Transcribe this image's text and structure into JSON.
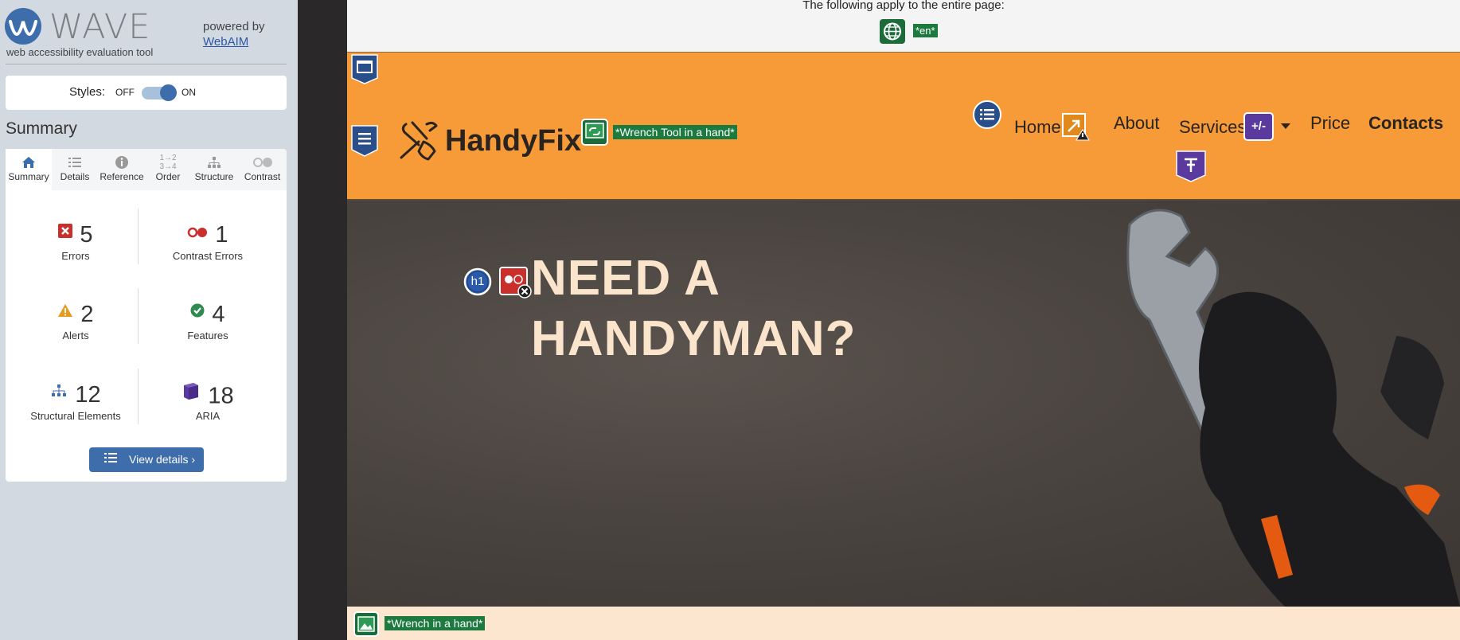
{
  "wave": {
    "title": "WAVE",
    "subtitle": "web accessibility evaluation tool",
    "powered_by": "powered by",
    "webaim_link": "WebAIM",
    "styles": {
      "label": "Styles:",
      "off": "OFF",
      "on": "ON",
      "state": "on"
    },
    "summary_heading": "Summary",
    "tabs": [
      {
        "label": "Summary",
        "icon": "home-icon"
      },
      {
        "label": "Details",
        "icon": "list-icon"
      },
      {
        "label": "Reference",
        "icon": "info-icon"
      },
      {
        "label": "Order",
        "icon": "order-icon"
      },
      {
        "label": "Structure",
        "icon": "structure-icon"
      },
      {
        "label": "Contrast",
        "icon": "contrast-icon"
      }
    ],
    "stats": {
      "errors": {
        "value": "5",
        "label": "Errors"
      },
      "contrast_errors": {
        "value": "1",
        "label": "Contrast Errors"
      },
      "alerts": {
        "value": "2",
        "label": "Alerts"
      },
      "features": {
        "value": "4",
        "label": "Features"
      },
      "structural": {
        "value": "12",
        "label": "Structural Elements"
      },
      "aria": {
        "value": "18",
        "label": "ARIA"
      }
    },
    "view_details": "View details ›"
  },
  "page": {
    "notice": "The following apply to the entire page:",
    "lang_label": "*en*",
    "brand": "HandyFix",
    "logo_alt": "*Wrench Tool in a hand*",
    "nav": [
      "Home",
      "About",
      "Services",
      "Price",
      "Contacts"
    ],
    "aria_plusminus": "+/-",
    "hero_heading": "NEED A HANDYMAN?",
    "h1_badge": "h1",
    "hero_image_alt": "*Wrench in a hand*"
  },
  "colors": {
    "wave_blue": "#3d6dab",
    "site_orange": "#f79a38",
    "wave_green_label": "#1c7a3f",
    "error_red": "#c9302c",
    "aria_purple": "#5b3aa0"
  }
}
